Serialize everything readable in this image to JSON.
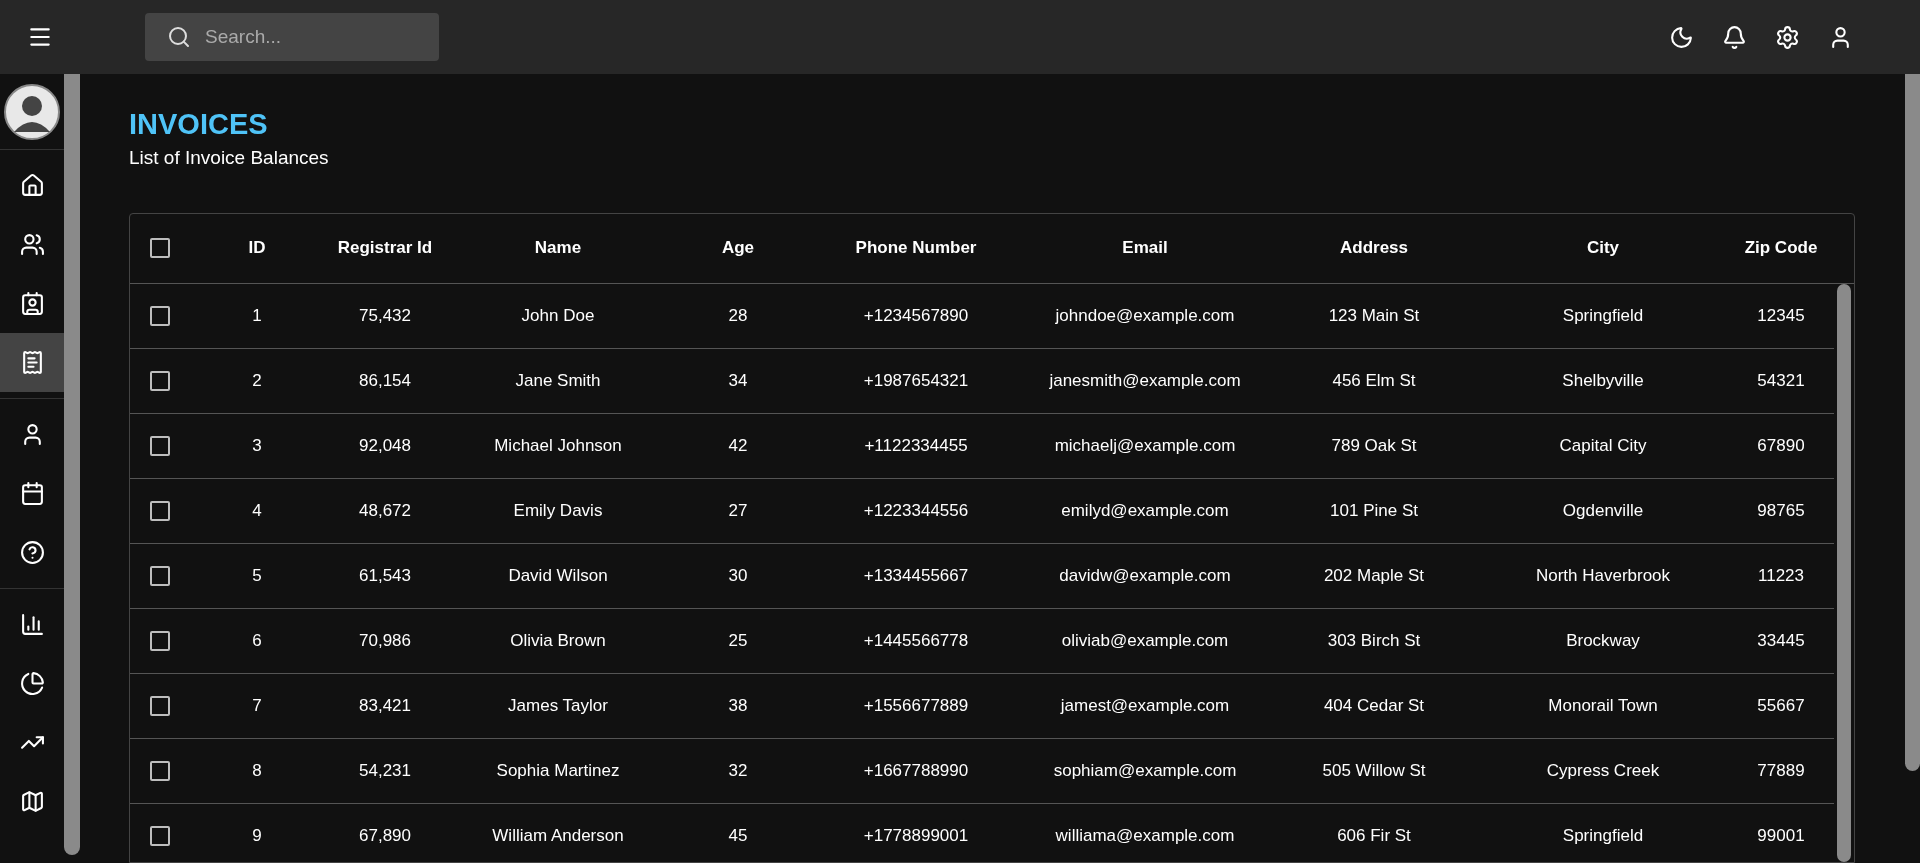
{
  "topbar": {
    "search": {
      "placeholder": "Search..."
    }
  },
  "sidebar": {
    "groups": [
      [
        {
          "selected": false
        },
        {
          "selected": false
        },
        {
          "selected": false
        },
        {
          "selected": true
        }
      ],
      [
        {
          "selected": false
        },
        {
          "selected": false
        },
        {
          "selected": false
        }
      ],
      [
        {
          "selected": false
        },
        {
          "selected": false
        },
        {
          "selected": false
        },
        {
          "selected": false
        }
      ]
    ]
  },
  "page": {
    "title": "INVOICES",
    "subtitle": "List of Invoice Balances"
  },
  "table": {
    "header_checked": false,
    "columns": [
      "ID",
      "Registrar Id",
      "Name",
      "Age",
      "Phone Number",
      "Email",
      "Address",
      "City",
      "Zip Code"
    ],
    "rows": [
      {
        "checked": false,
        "cells": [
          "1",
          "75,432",
          "John Doe",
          "28",
          "+1234567890",
          "johndoe@example.com",
          "123 Main St",
          "Springfield",
          "12345"
        ]
      },
      {
        "checked": false,
        "cells": [
          "2",
          "86,154",
          "Jane Smith",
          "34",
          "+1987654321",
          "janesmith@example.com",
          "456 Elm St",
          "Shelbyville",
          "54321"
        ]
      },
      {
        "checked": false,
        "cells": [
          "3",
          "92,048",
          "Michael Johnson",
          "42",
          "+1122334455",
          "michaelj@example.com",
          "789 Oak St",
          "Capital City",
          "67890"
        ]
      },
      {
        "checked": false,
        "cells": [
          "4",
          "48,672",
          "Emily Davis",
          "27",
          "+1223344556",
          "emilyd@example.com",
          "101 Pine St",
          "Ogdenville",
          "98765"
        ]
      },
      {
        "checked": false,
        "cells": [
          "5",
          "61,543",
          "David Wilson",
          "30",
          "+1334455667",
          "davidw@example.com",
          "202 Maple St",
          "North Haverbrook",
          "11223"
        ]
      },
      {
        "checked": false,
        "cells": [
          "6",
          "70,986",
          "Olivia Brown",
          "25",
          "+1445566778",
          "oliviab@example.com",
          "303 Birch St",
          "Brockway",
          "33445"
        ]
      },
      {
        "checked": false,
        "cells": [
          "7",
          "83,421",
          "James Taylor",
          "38",
          "+1556677889",
          "jamest@example.com",
          "404 Cedar St",
          "Monorail Town",
          "55667"
        ]
      },
      {
        "checked": false,
        "cells": [
          "8",
          "54,231",
          "Sophia Martinez",
          "32",
          "+1667788990",
          "sophiam@example.com",
          "505 Willow St",
          "Cypress Creek",
          "77889"
        ]
      },
      {
        "checked": false,
        "cells": [
          "9",
          "67,890",
          "William Anderson",
          "45",
          "+1778899001",
          "williama@example.com",
          "606 Fir St",
          "Springfield",
          "99001"
        ]
      }
    ]
  }
}
